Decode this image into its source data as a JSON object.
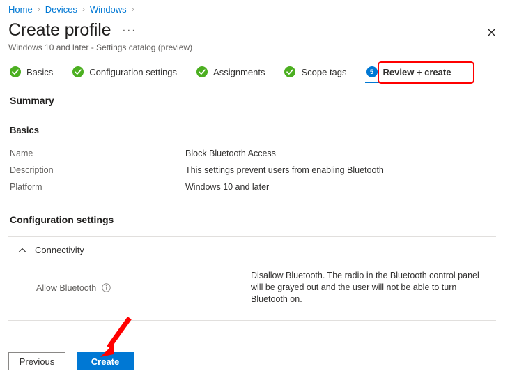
{
  "breadcrumb": {
    "separator": "›",
    "items": [
      {
        "label": "Home"
      },
      {
        "label": "Devices"
      },
      {
        "label": "Windows"
      }
    ]
  },
  "header": {
    "title": "Create profile",
    "more_actions": "···",
    "subtitle": "Windows 10 and later - Settings catalog (preview)",
    "close_icon": "close-icon"
  },
  "wizard": {
    "tabs": [
      {
        "label": "Basics",
        "state": "complete",
        "icon": "check-circle-icon"
      },
      {
        "label": "Configuration settings",
        "state": "complete",
        "icon": "check-circle-icon"
      },
      {
        "label": "Assignments",
        "state": "complete",
        "icon": "check-circle-icon"
      },
      {
        "label": "Scope tags",
        "state": "complete",
        "icon": "check-circle-icon"
      },
      {
        "label": "Review + create",
        "state": "current",
        "step": "5"
      }
    ]
  },
  "main": {
    "summary_heading": "Summary",
    "basics": {
      "heading": "Basics",
      "rows": [
        {
          "key": "Name",
          "value": "Block Bluetooth Access"
        },
        {
          "key": "Description",
          "value": "This settings prevent users from enabling Bluetooth"
        },
        {
          "key": "Platform",
          "value": "Windows 10 and later"
        }
      ]
    },
    "configuration_settings": {
      "heading": "Configuration settings",
      "group": {
        "label": "Connectivity",
        "expanded": true,
        "chevron_icon": "chevron-up-icon"
      },
      "settings": [
        {
          "name": "Allow Bluetooth",
          "info_icon": "info-icon",
          "value": "Disallow Bluetooth. The radio in the Bluetooth control panel will be grayed out and the user will not be able to turn Bluetooth on."
        }
      ]
    }
  },
  "footer": {
    "previous_label": "Previous",
    "create_label": "Create"
  },
  "annotations": {
    "tab_highlight": "red-rectangle-highlight",
    "create_arrow": "red-arrow-pointing-to-create-button"
  },
  "colors": {
    "accent_blue": "#0078d4",
    "link_blue": "#0078d4",
    "success_green": "#4caf21",
    "annotation_red": "#ff0000",
    "text_primary": "#323130",
    "text_secondary": "#605e5c",
    "divider": "#e1dfdd"
  }
}
